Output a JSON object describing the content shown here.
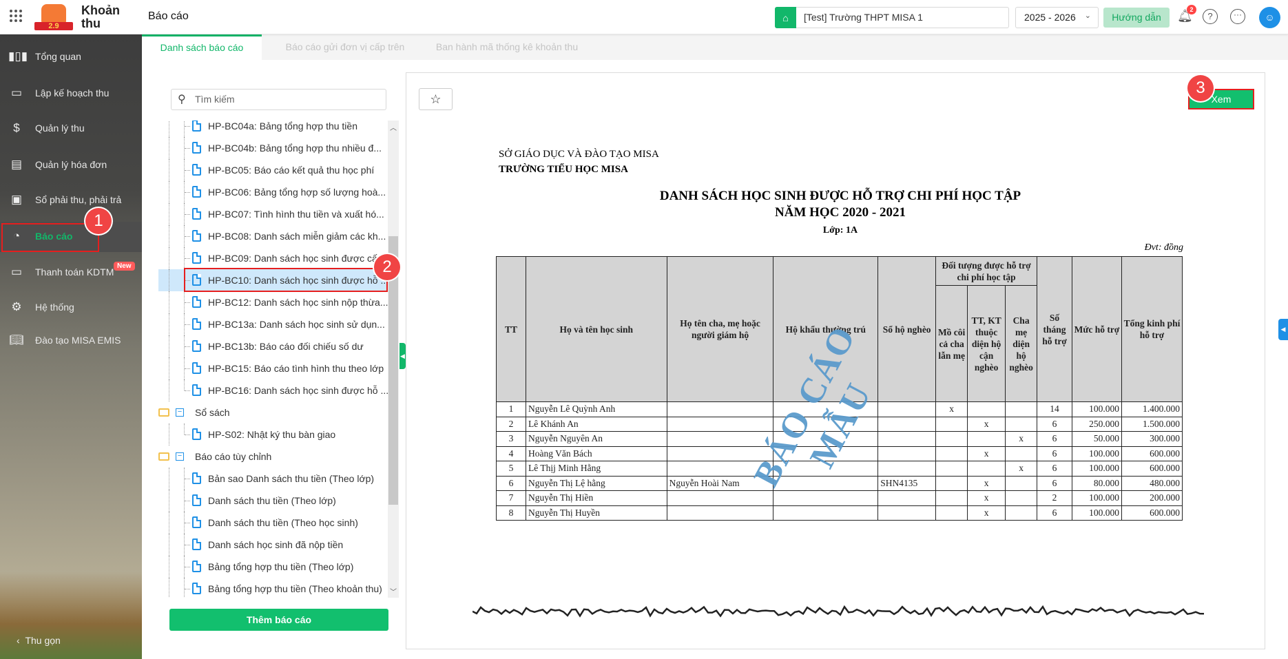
{
  "header": {
    "app_name_line1": "Khoản",
    "app_name_line2": "thu",
    "logo_version": "2.9",
    "page_title": "Báo cáo",
    "school": "[Test] Trường THPT MISA 1",
    "year": "2025 - 2026",
    "guide_label": "Hướng dẫn",
    "notification_count": "2"
  },
  "sidebar": {
    "items": [
      {
        "label": "Tổng quan",
        "icon": "chart-icon"
      },
      {
        "label": "Lập kế hoạch thu",
        "icon": "calendar-dollar-icon"
      },
      {
        "label": "Quản lý thu",
        "icon": "money-hand-icon"
      },
      {
        "label": "Quản lý hóa đơn",
        "icon": "invoice-icon"
      },
      {
        "label": "Sổ phải thu, phải trả",
        "icon": "ledger-icon"
      },
      {
        "label": "Báo cáo",
        "icon": "pie-chart-icon"
      },
      {
        "label": "Thanh toán KDTM",
        "icon": "card-icon"
      },
      {
        "label": "Hệ thống",
        "icon": "gear-icon"
      },
      {
        "label": "Đào tạo MISA EMIS",
        "icon": "book-icon"
      }
    ],
    "new_badge": "New",
    "collapse_label": "Thu gọn"
  },
  "steps": [
    "1",
    "2",
    "3"
  ],
  "tabs": [
    "Danh sách báo cáo",
    "Báo cáo gửi đơn vị cấp trên",
    "Ban hành mã thống kê khoản thu"
  ],
  "search": {
    "placeholder": "Tìm kiếm"
  },
  "tree": [
    {
      "type": "file",
      "label": "HP-BC04a: Bảng tổng hợp thu tiền"
    },
    {
      "type": "file",
      "label": "HP-BC04b: Bảng tổng hợp thu nhiều đ..."
    },
    {
      "type": "file",
      "label": "HP-BC05: Báo cáo kết quả thu học phí"
    },
    {
      "type": "file",
      "label": "HP-BC06: Bảng tổng hợp số lượng hoà..."
    },
    {
      "type": "file",
      "label": "HP-BC07: Tình hình thu tiền và xuất hó..."
    },
    {
      "type": "file",
      "label": "HP-BC08: Danh sách miễn giảm các kh..."
    },
    {
      "type": "file",
      "label": "HP-BC09: Danh sách học sinh được cấ..."
    },
    {
      "type": "file",
      "label": "HP-BC10: Danh sách học sinh được hỗ ...",
      "selected": true
    },
    {
      "type": "file",
      "label": "HP-BC12: Danh sách học sinh nộp thừa..."
    },
    {
      "type": "file",
      "label": "HP-BC13a: Danh sách học sinh sử dụn..."
    },
    {
      "type": "file",
      "label": "HP-BC13b: Báo cáo đối chiếu số dư"
    },
    {
      "type": "file",
      "label": "HP-BC15: Báo cáo tình hình thu theo lớp"
    },
    {
      "type": "file",
      "label": "HP-BC16: Danh sách học sinh được hỗ ...",
      "last": true
    },
    {
      "type": "folder",
      "label": "Sổ sách"
    },
    {
      "type": "file",
      "label": "HP-S02: Nhật ký thu bàn giao",
      "last": true
    },
    {
      "type": "folder",
      "label": "Báo cáo tùy chỉnh"
    },
    {
      "type": "file",
      "label": "Bản sao Danh sách thu tiền (Theo lớp)"
    },
    {
      "type": "file",
      "label": "Danh sách thu tiền (Theo lớp)"
    },
    {
      "type": "file",
      "label": "Danh sách thu tiền (Theo học sinh)"
    },
    {
      "type": "file",
      "label": "Danh sách học sinh đã nộp tiền"
    },
    {
      "type": "file",
      "label": "Bảng tổng hợp thu tiền (Theo lớp)"
    },
    {
      "type": "file",
      "label": "Bảng tổng hợp thu tiền (Theo khoản thu)"
    }
  ],
  "add_report_label": "Thêm báo cáo",
  "view_label": "Xem",
  "report": {
    "org": "SỞ GIÁO DỤC VÀ ĐÀO TẠO MISA",
    "school": "TRƯỜNG TIỂU HỌC MISA",
    "title": "DANH SÁCH HỌC SINH ĐƯỢC HỖ TRỢ CHI PHÍ HỌC TẬP",
    "year": "NĂM HỌC 2020 - 2021",
    "class": "Lớp: 1A",
    "unit": "Đvt: đồng",
    "watermark": "BÁO CÁO MẪU",
    "headers": {
      "tt": "TT",
      "name": "Họ và tên học sinh",
      "guardian": "Họ tên cha, mẹ hoặc người giám hộ",
      "address": "Hộ khẩu thường trú",
      "poor_book": "Sổ hộ nghèo",
      "group": "Đối tượng được hỗ trợ chi phí học tập",
      "orphan": "Mồ côi cả cha lẫn mẹ",
      "near_poor": "TT, KT thuộc diện hộ cận nghèo",
      "poor_parent": "Cha mẹ diện hộ nghèo",
      "months": "Số tháng hỗ trợ",
      "rate": "Mức hỗ trợ",
      "total": "Tổng kinh phí hỗ trợ"
    },
    "rows": [
      [
        "1",
        "Nguyễn Lê Quỳnh Anh",
        "",
        "",
        "",
        "x",
        "",
        "",
        "14",
        "100.000",
        "1.400.000"
      ],
      [
        "2",
        "Lê Khánh An",
        "",
        "",
        "",
        "",
        "x",
        "",
        "6",
        "250.000",
        "1.500.000"
      ],
      [
        "3",
        "Nguyễn Nguyên An",
        "",
        "",
        "",
        "",
        "",
        "x",
        "6",
        "50.000",
        "300.000"
      ],
      [
        "4",
        "Hoàng Văn Bách",
        "",
        "",
        "",
        "",
        "x",
        "",
        "6",
        "100.000",
        "600.000"
      ],
      [
        "5",
        "Lê Thịj Minh Hằng",
        "",
        "",
        "",
        "",
        "",
        "x",
        "6",
        "100.000",
        "600.000"
      ],
      [
        "6",
        "Nguyễn Thị Lệ hằng",
        "Nguyễn Hoài Nam",
        "",
        "SHN4135",
        "",
        "x",
        "",
        "6",
        "80.000",
        "480.000"
      ],
      [
        "7",
        "Nguyễn Thị Hiền",
        "",
        "",
        "",
        "",
        "x",
        "",
        "2",
        "100.000",
        "200.000"
      ],
      [
        "8",
        "Nguyễn Thị Huyền",
        "",
        "",
        "",
        "",
        "x",
        "",
        "6",
        "100.000",
        "600.000"
      ]
    ]
  }
}
